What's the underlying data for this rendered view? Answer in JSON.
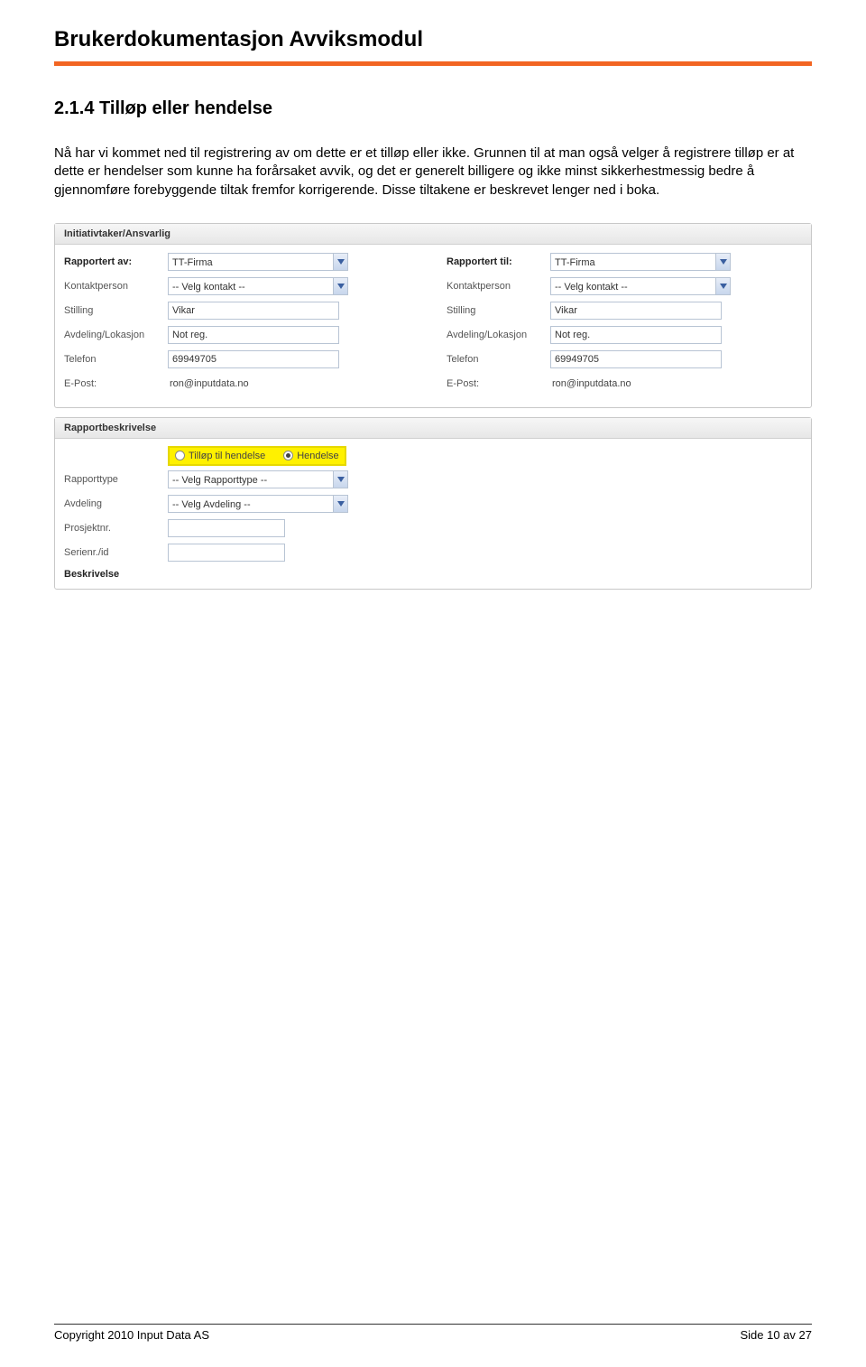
{
  "doc": {
    "title": "Brukerdokumentasjon Avviksmodul",
    "section_heading": "2.1.4 Tilløp eller hendelse",
    "paragraph": "Nå har vi kommet ned til registrering av om dette er et tilløp eller ikke. Grunnen til at man også velger å registrere tilløp er at dette er hendelser som kunne ha forårsaket avvik, og det er generelt billigere og ikke minst sikkerhestmessig bedre å gjennomføre forebyggende tiltak fremfor korrigerende. Disse tiltakene er beskrevet lenger ned i boka."
  },
  "panels": {
    "init": {
      "header": "Initiativtaker/Ansvarlig",
      "left": {
        "rapportert_av_label": "Rapportert av:",
        "rapportert_av_value": "TT-Firma",
        "kontakt_label": "Kontaktperson",
        "kontakt_value": "-- Velg kontakt --",
        "stilling_label": "Stilling",
        "stilling_value": "Vikar",
        "avdeling_label": "Avdeling/Lokasjon",
        "avdeling_value": "Not reg.",
        "telefon_label": "Telefon",
        "telefon_value": "69949705",
        "epost_label": "E-Post:",
        "epost_value": "ron@inputdata.no"
      },
      "right": {
        "rapportert_til_label": "Rapportert til:",
        "rapportert_til_value": "TT-Firma",
        "kontakt_label": "Kontaktperson",
        "kontakt_value": "-- Velg kontakt --",
        "stilling_label": "Stilling",
        "stilling_value": "Vikar",
        "avdeling_label": "Avdeling/Lokasjon",
        "avdeling_value": "Not reg.",
        "telefon_label": "Telefon",
        "telefon_value": "69949705",
        "epost_label": "E-Post:",
        "epost_value": "ron@inputdata.no"
      }
    },
    "rapport": {
      "header": "Rapportbeskrivelse",
      "radio1": "Tilløp til hendelse",
      "radio2": "Hendelse",
      "rapporttype_label": "Rapporttype",
      "rapporttype_value": "-- Velg Rapporttype --",
      "avdeling_label": "Avdeling",
      "avdeling_value": "-- Velg Avdeling --",
      "prosjekt_label": "Prosjektnr.",
      "prosjekt_value": "",
      "serie_label": "Serienr./id",
      "serie_value": "",
      "beskrivelse_label": "Beskrivelse"
    }
  },
  "footer": {
    "left": "Copyright 2010 Input Data AS",
    "right": "Side 10 av 27"
  }
}
